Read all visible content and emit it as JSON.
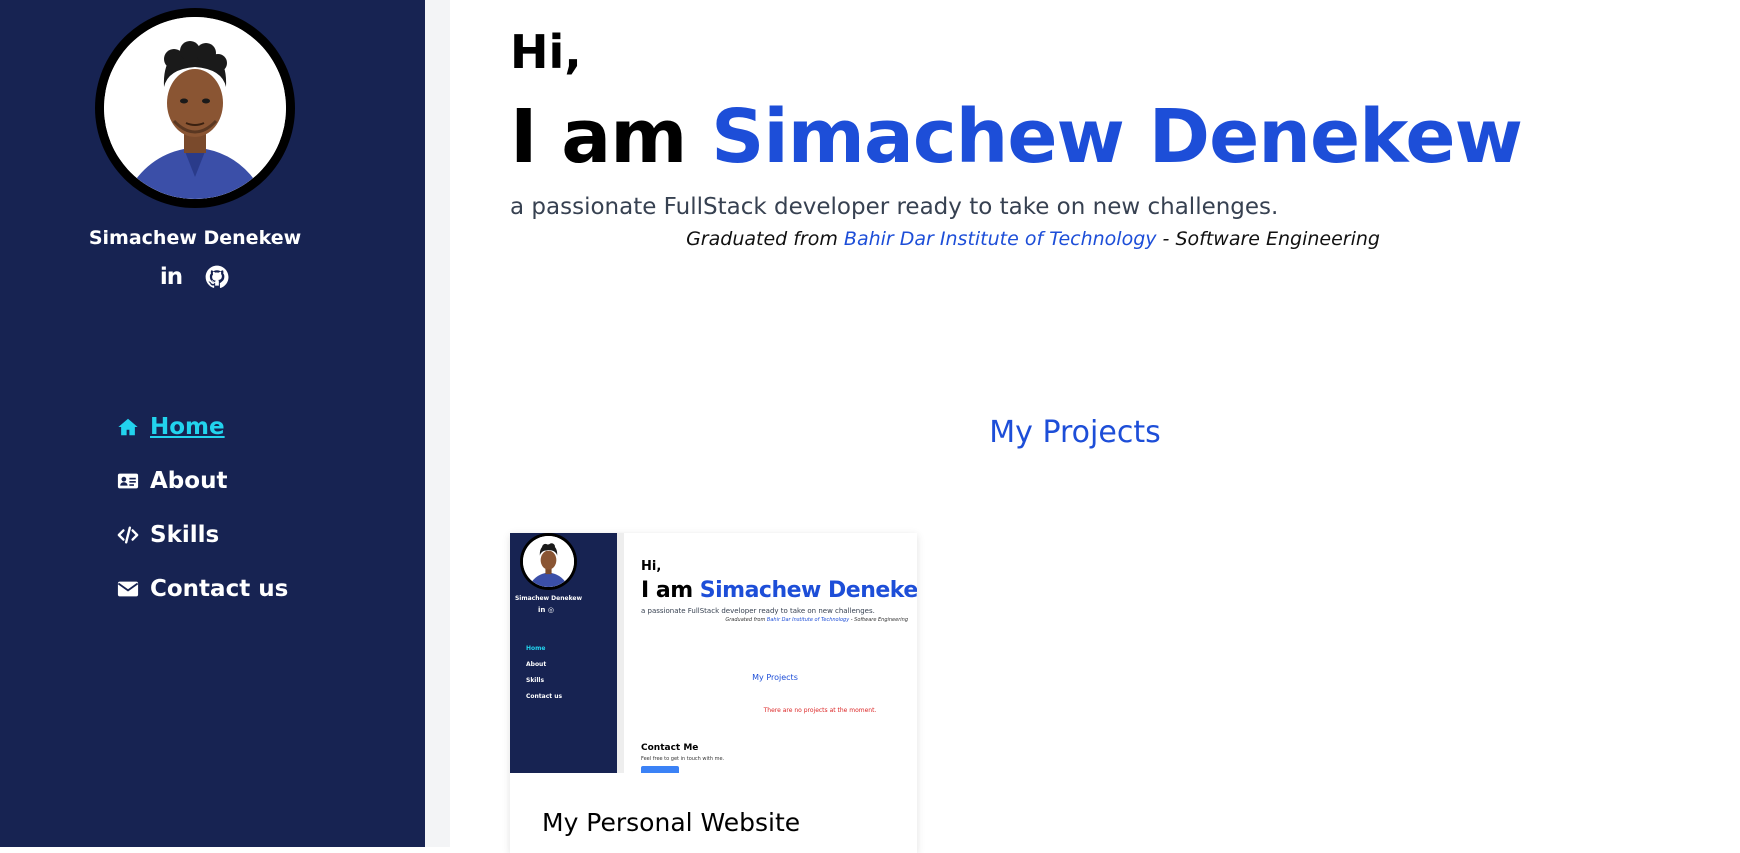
{
  "sidebar": {
    "name": "Simachew Denekew",
    "social": [
      {
        "icon": "linkedin-icon",
        "label": "in"
      },
      {
        "icon": "github-icon"
      }
    ],
    "nav": [
      {
        "label": "Home",
        "icon": "home-icon",
        "active": true
      },
      {
        "label": "About",
        "icon": "id-card-icon",
        "active": false
      },
      {
        "label": "Skills",
        "icon": "code-icon",
        "active": false
      },
      {
        "label": "Contact us",
        "icon": "envelope-icon",
        "active": false
      }
    ]
  },
  "hero": {
    "greeting": "Hi,",
    "intro_prefix": "I am ",
    "intro_name": "Simachew Denekew",
    "tagline": "a passionate FullStack developer ready to take on new challenges.",
    "education_prefix": "Graduated from ",
    "education_institution": "Bahir Dar Institute of Technology",
    "education_suffix": " - Software Engineering"
  },
  "projects": {
    "title": "My Projects",
    "items": [
      {
        "title": "My Personal Website",
        "thumbnail": {
          "sidebar_name": "Simachew Denekew",
          "social": "in  ◎",
          "nav": [
            "Home",
            "About",
            "Skills",
            "Contact us"
          ],
          "greeting": "Hi,",
          "intro_prefix": "I am ",
          "intro_name": "Simachew Denekew",
          "tagline": "a passionate FullStack developer ready to take on new challenges.",
          "education_prefix": "Graduated from ",
          "education_institution": "Bahir Dar Institute of Technology",
          "education_suffix": " - Software Engineering",
          "projects_title": "My Projects",
          "error_text": "There are no projects at the moment.",
          "contact_title": "Contact Me",
          "contact_sub": "Feel free to get in touch with me."
        }
      }
    ]
  },
  "colors": {
    "sidebar_bg": "#172352",
    "accent_blue": "#1d4ed8",
    "active_nav": "#22d3ee"
  }
}
